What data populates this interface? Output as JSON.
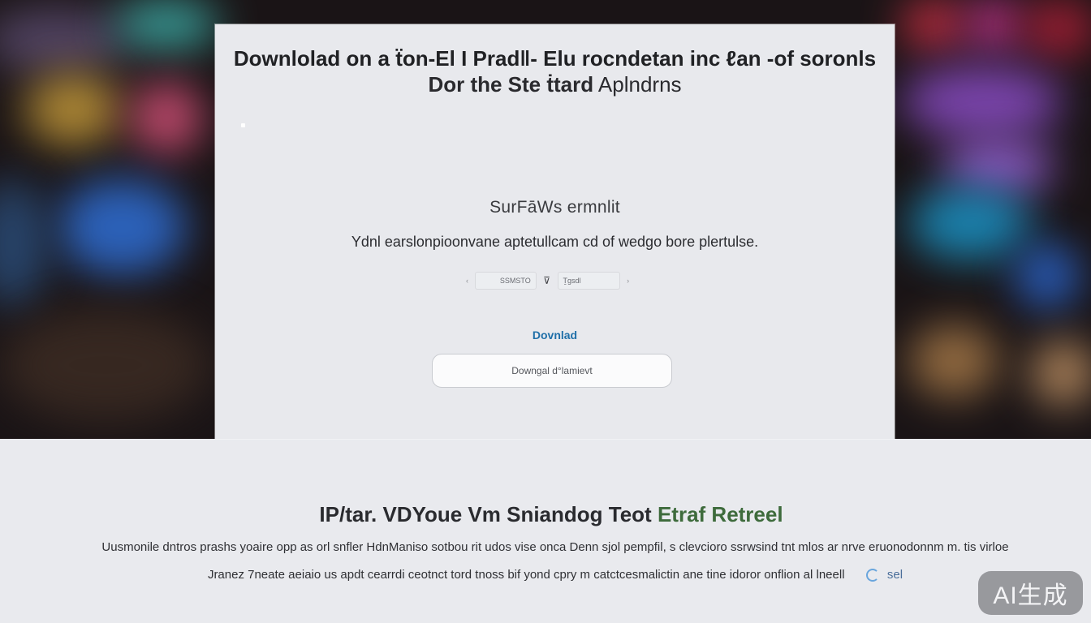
{
  "card": {
    "title_line1": "Downlolad on a ẗon-El I Pradǁ- Elu rocndetan inc ℓan -of soronls",
    "title_line2_bold": "Dor the Ste ṫtard",
    "title_line2_regular": "Aplndrns",
    "subheading": "SurFāWs ermnlit",
    "description": "Ydnl earslonpioonvane aptetullcam cd of wedgo bore plertulse.",
    "mini_left_value": "SSMSTO",
    "mini_icon": "filter-icon",
    "mini_right_value": "Ṯgsdl",
    "download_link": "Dovnlad",
    "download_button": "Downgal d°lamievt"
  },
  "section": {
    "title_main": "IP/tar. VDYoue Vm Sniandog Teot",
    "title_accent": "Etraf Retreel",
    "accent_color": "#3e6b3c",
    "body_line1": "Uusmonile dntros prashs yoaire opp as orl snfler  HdnManiso sotbou rit udos vise onca Denn sjol pempfil, s clevcioro  ssrwsind tnt  mlos ar nrve  eruonodonnm m. tis virloe",
    "body_line2": "Jranez  7neate aeiaio us apdt cearrdi ceotnct tord tnoss bif yond cpry m catctcesmalictin ane tine idoror onflion al lneell",
    "body_line2_link": "sel"
  },
  "badge": "AI生成",
  "colors": {
    "link": "#1f6fa8",
    "card_bg": "#e8e9ed",
    "page_bg": "#e9eaee"
  }
}
